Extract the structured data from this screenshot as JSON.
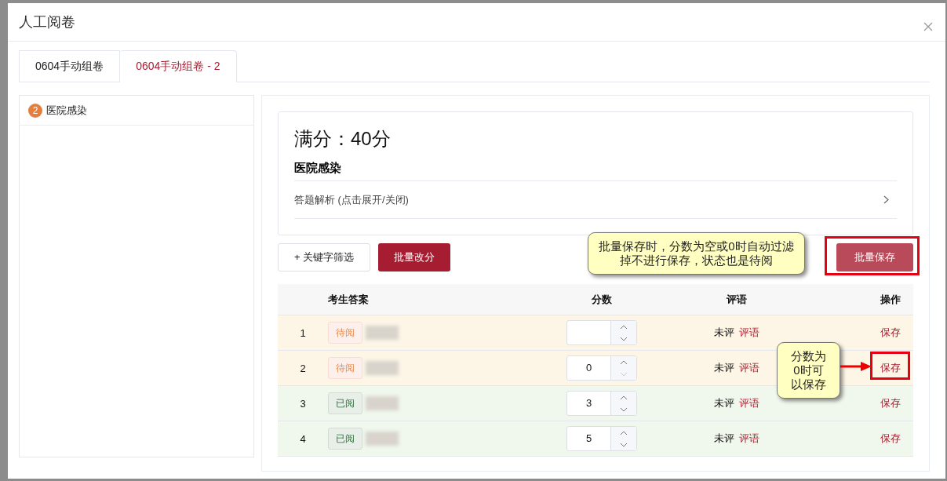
{
  "dialog": {
    "title": "人工阅卷"
  },
  "tabs": [
    {
      "label": "0604手动组卷",
      "selected": false
    },
    {
      "label": "0604手动组卷 - 2",
      "selected": true
    }
  ],
  "sidebar": {
    "items": [
      {
        "badge": "2",
        "label": "医院感染"
      }
    ]
  },
  "question": {
    "full_score": "满分：40分",
    "title": "医院感染",
    "analysis": "答题解析 (点击展开/关闭)"
  },
  "toolbar": {
    "filter_button": "+ 关键字筛选",
    "batch_score_button": "批量改分",
    "batch_save_button": "批量保存",
    "batch_save_highlighted": true
  },
  "table": {
    "columns": [
      "考生答案",
      "分数",
      "评语",
      "操作"
    ],
    "rows": [
      {
        "index": "1",
        "status": "待阅",
        "kind": "pending",
        "comment_status": "未评",
        "comment_link": "评语",
        "action": "保存",
        "decrement_disabled": false,
        "highlighted": false
      },
      {
        "index": "2",
        "status": "待阅",
        "kind": "pending",
        "score": "0",
        "comment_status": "未评",
        "comment_link": "评语",
        "action": "保存",
        "decrement_disabled": true,
        "highlighted": true
      },
      {
        "index": "3",
        "status": "已阅",
        "kind": "done",
        "score": "3",
        "comment_status": "未评",
        "comment_link": "评语",
        "action": "保存",
        "decrement_disabled": false,
        "highlighted": false
      },
      {
        "index": "4",
        "status": "已阅",
        "kind": "done",
        "score": "5",
        "comment_status": "未评",
        "comment_link": "评语",
        "action": "保存",
        "decrement_disabled": false,
        "highlighted": false
      }
    ]
  },
  "annotations": [
    {
      "kind": "wide",
      "text": "批量保存时，分数为空或0时自动过滤掉不进行保存，状态也是待阅"
    },
    {
      "kind": "narrow",
      "text": "分数为0时可以保存"
    }
  ]
}
